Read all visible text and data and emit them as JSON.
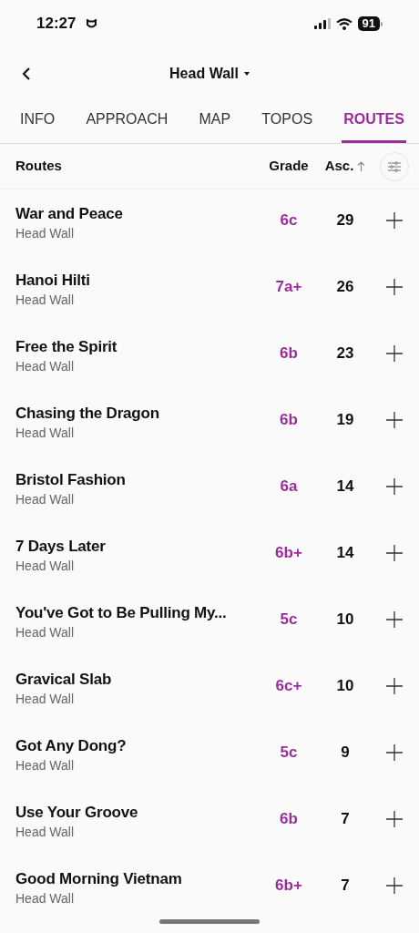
{
  "status_bar": {
    "time": "12:27",
    "battery": "91"
  },
  "nav": {
    "title": "Head Wall"
  },
  "tabs": [
    {
      "label": "INFO",
      "selected": false
    },
    {
      "label": "APPROACH",
      "selected": false
    },
    {
      "label": "MAP",
      "selected": false
    },
    {
      "label": "TOPOS",
      "selected": false
    },
    {
      "label": "ROUTES",
      "selected": true
    }
  ],
  "table": {
    "columns": [
      "Routes",
      "Grade",
      "Asc."
    ],
    "rows": [
      {
        "name": "War and Peace",
        "crag": "Head Wall",
        "grade": "6c",
        "ascents": "29"
      },
      {
        "name": "Hanoi Hilti",
        "crag": "Head Wall",
        "grade": "7a+",
        "ascents": "26"
      },
      {
        "name": "Free the Spirit",
        "crag": "Head Wall",
        "grade": "6b",
        "ascents": "23"
      },
      {
        "name": "Chasing the Dragon",
        "crag": "Head Wall",
        "grade": "6b",
        "ascents": "19"
      },
      {
        "name": "Bristol Fashion",
        "crag": "Head Wall",
        "grade": "6a",
        "ascents": "14"
      },
      {
        "name": "7 Days Later",
        "crag": "Head Wall",
        "grade": "6b+",
        "ascents": "14"
      },
      {
        "name": "You've Got to Be Pulling My...",
        "crag": "Head Wall",
        "grade": "5c",
        "ascents": "10"
      },
      {
        "name": "Gravical Slab",
        "crag": "Head Wall",
        "grade": "6c+",
        "ascents": "10"
      },
      {
        "name": "Got Any Dong?",
        "crag": "Head Wall",
        "grade": "5c",
        "ascents": "9"
      },
      {
        "name": "Use Your Groove",
        "crag": "Head Wall",
        "grade": "6b",
        "ascents": "7"
      },
      {
        "name": "Good Morning Vietnam",
        "crag": "Head Wall",
        "grade": "6b+",
        "ascents": "7"
      }
    ]
  }
}
